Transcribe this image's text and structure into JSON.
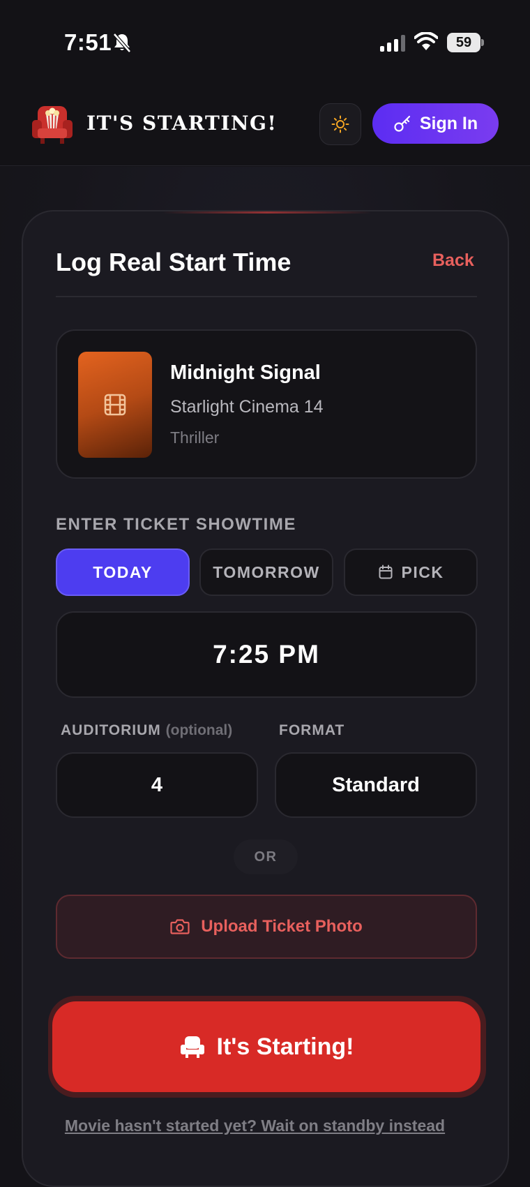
{
  "status_bar": {
    "time": "7:51",
    "battery": "59",
    "icons": [
      "bell-slash-icon",
      "signal-icon",
      "wifi-icon",
      "battery-icon"
    ]
  },
  "header": {
    "brand": "IT'S STARTING!",
    "logo_icon": "cinema-seat-popcorn-icon",
    "theme_icon": "sun-icon",
    "sign_in_label": "Sign In",
    "sign_in_icon": "key-icon"
  },
  "card": {
    "title": "Log Real Start Time",
    "back_label": "Back"
  },
  "movie": {
    "title": "Midnight Signal",
    "theater": "Starlight Cinema 14",
    "genre": "Thriller",
    "poster_icon": "film-icon"
  },
  "showtime": {
    "section_label": "ENTER TICKET SHOWTIME",
    "days": {
      "today": "TODAY",
      "tomorrow": "TOMORROW",
      "pick": "PICK"
    },
    "selected_day": "TODAY",
    "time": "7:25 PM"
  },
  "auditorium": {
    "label": "AUDITORIUM",
    "optional_note": "(optional)",
    "value": "4"
  },
  "format": {
    "label": "FORMAT",
    "value": "Standard"
  },
  "divider_or": "OR",
  "upload": {
    "label": "Upload Ticket Photo",
    "icon": "camera-icon"
  },
  "start_button": {
    "label": "It's Starting!",
    "icon": "theater-seat-icon"
  },
  "standby_link": "Movie hasn't started yet? Wait on standby instead",
  "colors": {
    "accent_purple": "#4d3df0",
    "accent_red": "#d82a26",
    "link_red": "#e8605d",
    "background": "#141318"
  }
}
